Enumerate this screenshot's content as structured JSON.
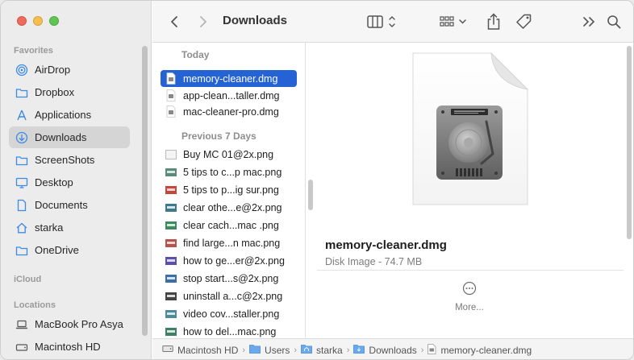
{
  "toolbar": {
    "title": "Downloads"
  },
  "sidebar": {
    "favorites_label": "Favorites",
    "icloud_label": "iCloud",
    "locations_label": "Locations",
    "items": [
      {
        "label": "AirDrop",
        "icon": "airdrop-icon"
      },
      {
        "label": "Dropbox",
        "icon": "folder-icon"
      },
      {
        "label": "Applications",
        "icon": "applications-icon"
      },
      {
        "label": "Downloads",
        "icon": "downloads-icon"
      },
      {
        "label": "ScreenShots",
        "icon": "folder-icon"
      },
      {
        "label": "Desktop",
        "icon": "desktop-icon"
      },
      {
        "label": "Documents",
        "icon": "document-icon"
      },
      {
        "label": "starka",
        "icon": "home-icon"
      },
      {
        "label": "OneDrive",
        "icon": "folder-icon"
      }
    ],
    "locations": [
      {
        "label": "MacBook Pro Asya",
        "icon": "laptop-icon"
      },
      {
        "label": "Macintosh HD",
        "icon": "disk-icon"
      }
    ]
  },
  "column": {
    "today_label": "Today",
    "previous_label": "Previous 7 Days",
    "today_files": [
      "memory-cleaner.dmg",
      "app-clean...taller.dmg",
      "mac-cleaner-pro.dmg"
    ],
    "previous_files": [
      "Buy MC 01@2x.png",
      "5 tips to c...p mac.png",
      "5 tips to p...ig sur.png",
      "clear othe...e@2x.png",
      "clear cach...mac .png",
      "find large...n mac.png",
      "how to ge...er@2x.png",
      "stop start...s@2x.png",
      "uninstall a...c@2x.png",
      "video cov...staller.png",
      "how to del...mac.png"
    ]
  },
  "preview": {
    "name": "memory-cleaner.dmg",
    "meta": "Disk Image - 74.7 MB",
    "more_label": "More..."
  },
  "pathbar": {
    "crumbs": [
      "Macintosh HD",
      "Users",
      "starka",
      "Downloads",
      "memory-cleaner.dmg"
    ]
  },
  "colors": {
    "selection": "#2563d5",
    "sidebar_bg": "#ececec",
    "folder_blue": "#3d8ae3"
  }
}
